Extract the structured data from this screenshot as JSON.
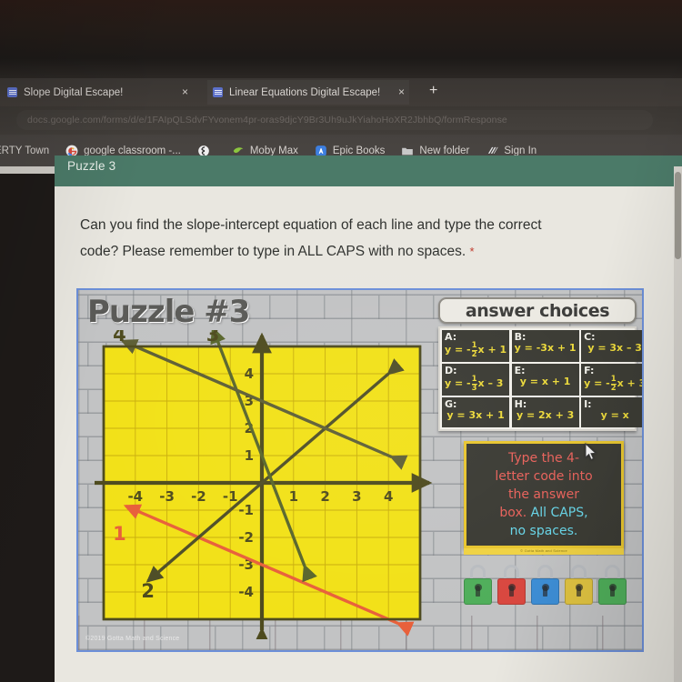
{
  "browser": {
    "tabs": [
      {
        "title": "Slope Digital Escape!",
        "active": false,
        "close_label": "×"
      },
      {
        "title": "Linear Equations Digital Escape!",
        "active": true,
        "close_label": "×"
      }
    ],
    "new_tab_label": "+",
    "omnibox": {
      "url": "docs.google.com/forms/d/e/1FAIpQLSdvFYvonem4pr-oras9djcY9Br3Uh9uJkYiahoHoXR2JbhbQ/formResponse"
    },
    "bookmarks": [
      {
        "label": "ERTY Town",
        "icon": "none-icon"
      },
      {
        "label": "google classroom -...",
        "icon": "google-icon"
      },
      {
        "label": "",
        "icon": "globe-icon"
      },
      {
        "label": "Moby Max",
        "icon": "mobymax-icon"
      },
      {
        "label": "Epic Books",
        "icon": "epic-icon"
      },
      {
        "label": "New folder",
        "icon": "folder-icon"
      },
      {
        "label": "Sign In",
        "icon": "signin-icon"
      }
    ]
  },
  "form": {
    "section_title": "Puzzle 3",
    "question_line1": "Can you find the slope-intercept equation of each line and type the correct",
    "question_line2": "code? Please remember to type in ALL CAPS with no spaces.",
    "required_mark": "*"
  },
  "worksheet": {
    "title": "Puzzle #3",
    "copyright": "©2019 Gotta Math and Science",
    "answer_panel": {
      "heading": "answer choices",
      "cells": [
        {
          "key": "A:",
          "eq_parts": [
            {
              "t": "y = -"
            },
            {
              "frac": [
                "1",
                "2"
              ]
            },
            {
              "t": "x + 1"
            }
          ]
        },
        {
          "key": "B:",
          "eq_parts": [
            {
              "t": "y = -3x + 1"
            }
          ]
        },
        {
          "key": "C:",
          "eq_parts": [
            {
              "t": "y = 3x – 3"
            }
          ]
        },
        {
          "key": "D:",
          "eq_parts": [
            {
              "t": "y = -"
            },
            {
              "frac": [
                "1",
                "3"
              ]
            },
            {
              "t": "x – 3"
            }
          ]
        },
        {
          "key": "E:",
          "eq_parts": [
            {
              "t": "y = x + 1"
            }
          ]
        },
        {
          "key": "F:",
          "eq_parts": [
            {
              "t": "y = -"
            },
            {
              "frac": [
                "1",
                "2"
              ]
            },
            {
              "t": "x + 3"
            }
          ]
        },
        {
          "key": "G:",
          "eq_parts": [
            {
              "t": "y = 3x + 1"
            }
          ]
        },
        {
          "key": "H:",
          "eq_parts": [
            {
              "t": "y = 2x + 3"
            }
          ]
        },
        {
          "key": "I:",
          "eq_parts": [
            {
              "t": "y = x"
            }
          ]
        }
      ]
    },
    "note": {
      "line1": "Type the 4-",
      "line2": "letter code into",
      "line3": "the answer",
      "line4a": "box.",
      "line4b": " All CAPS,",
      "line5": "no spaces.",
      "footer": "© Gotta Math and Science"
    },
    "locks": [
      {
        "color": "#4fae5a"
      },
      {
        "color": "#d9473f"
      },
      {
        "color": "#3d8ed6"
      },
      {
        "color": "#e0c341"
      },
      {
        "color": "#4fae5a"
      }
    ]
  },
  "chart_data": {
    "type": "line",
    "title": "Puzzle #3",
    "xlabel": "",
    "ylabel": "",
    "xlim": [
      -5,
      5
    ],
    "ylim": [
      -5,
      5
    ],
    "grid": true,
    "x_ticks": [
      "-4",
      "-3",
      "-2",
      "-1",
      "1",
      "2",
      "3",
      "4"
    ],
    "y_ticks": [
      "4",
      "3",
      "2",
      "1",
      "-1",
      "-2",
      "-3",
      "-4"
    ],
    "plot_bg": "#f2e117",
    "series": [
      {
        "name": "1",
        "label": "1",
        "color": "#e8603a",
        "slope": -0.5,
        "intercept": -3,
        "from": [
          -4.3,
          -0.85
        ],
        "to": [
          4.3,
          -5.15
        ],
        "label_pos": [
          -4.5,
          -2.1
        ],
        "answer_key": "A"
      },
      {
        "name": "2",
        "label": "2",
        "color": "#4f4f28",
        "slope": 1,
        "intercept": 0,
        "from": [
          -3.6,
          -3.6
        ],
        "to": [
          4.0,
          4.0
        ],
        "label_pos": [
          -3.6,
          -4.2
        ],
        "answer_key": "I"
      },
      {
        "name": "3",
        "label": "3",
        "color": "#59662c",
        "slope": -3,
        "intercept": 1,
        "from": [
          -1.55,
          5.65
        ],
        "to": [
          1.35,
          -3.05
        ],
        "label_pos": [
          -1.55,
          5.2
        ],
        "answer_key": "B"
      },
      {
        "name": "4",
        "label": "4",
        "color": "#5e5f35",
        "slope": -0.5,
        "intercept": 3,
        "from": [
          -4.4,
          5.2
        ],
        "to": [
          4.1,
          0.95
        ],
        "label_pos": [
          -4.5,
          5.2
        ],
        "answer_key": "F"
      }
    ]
  }
}
